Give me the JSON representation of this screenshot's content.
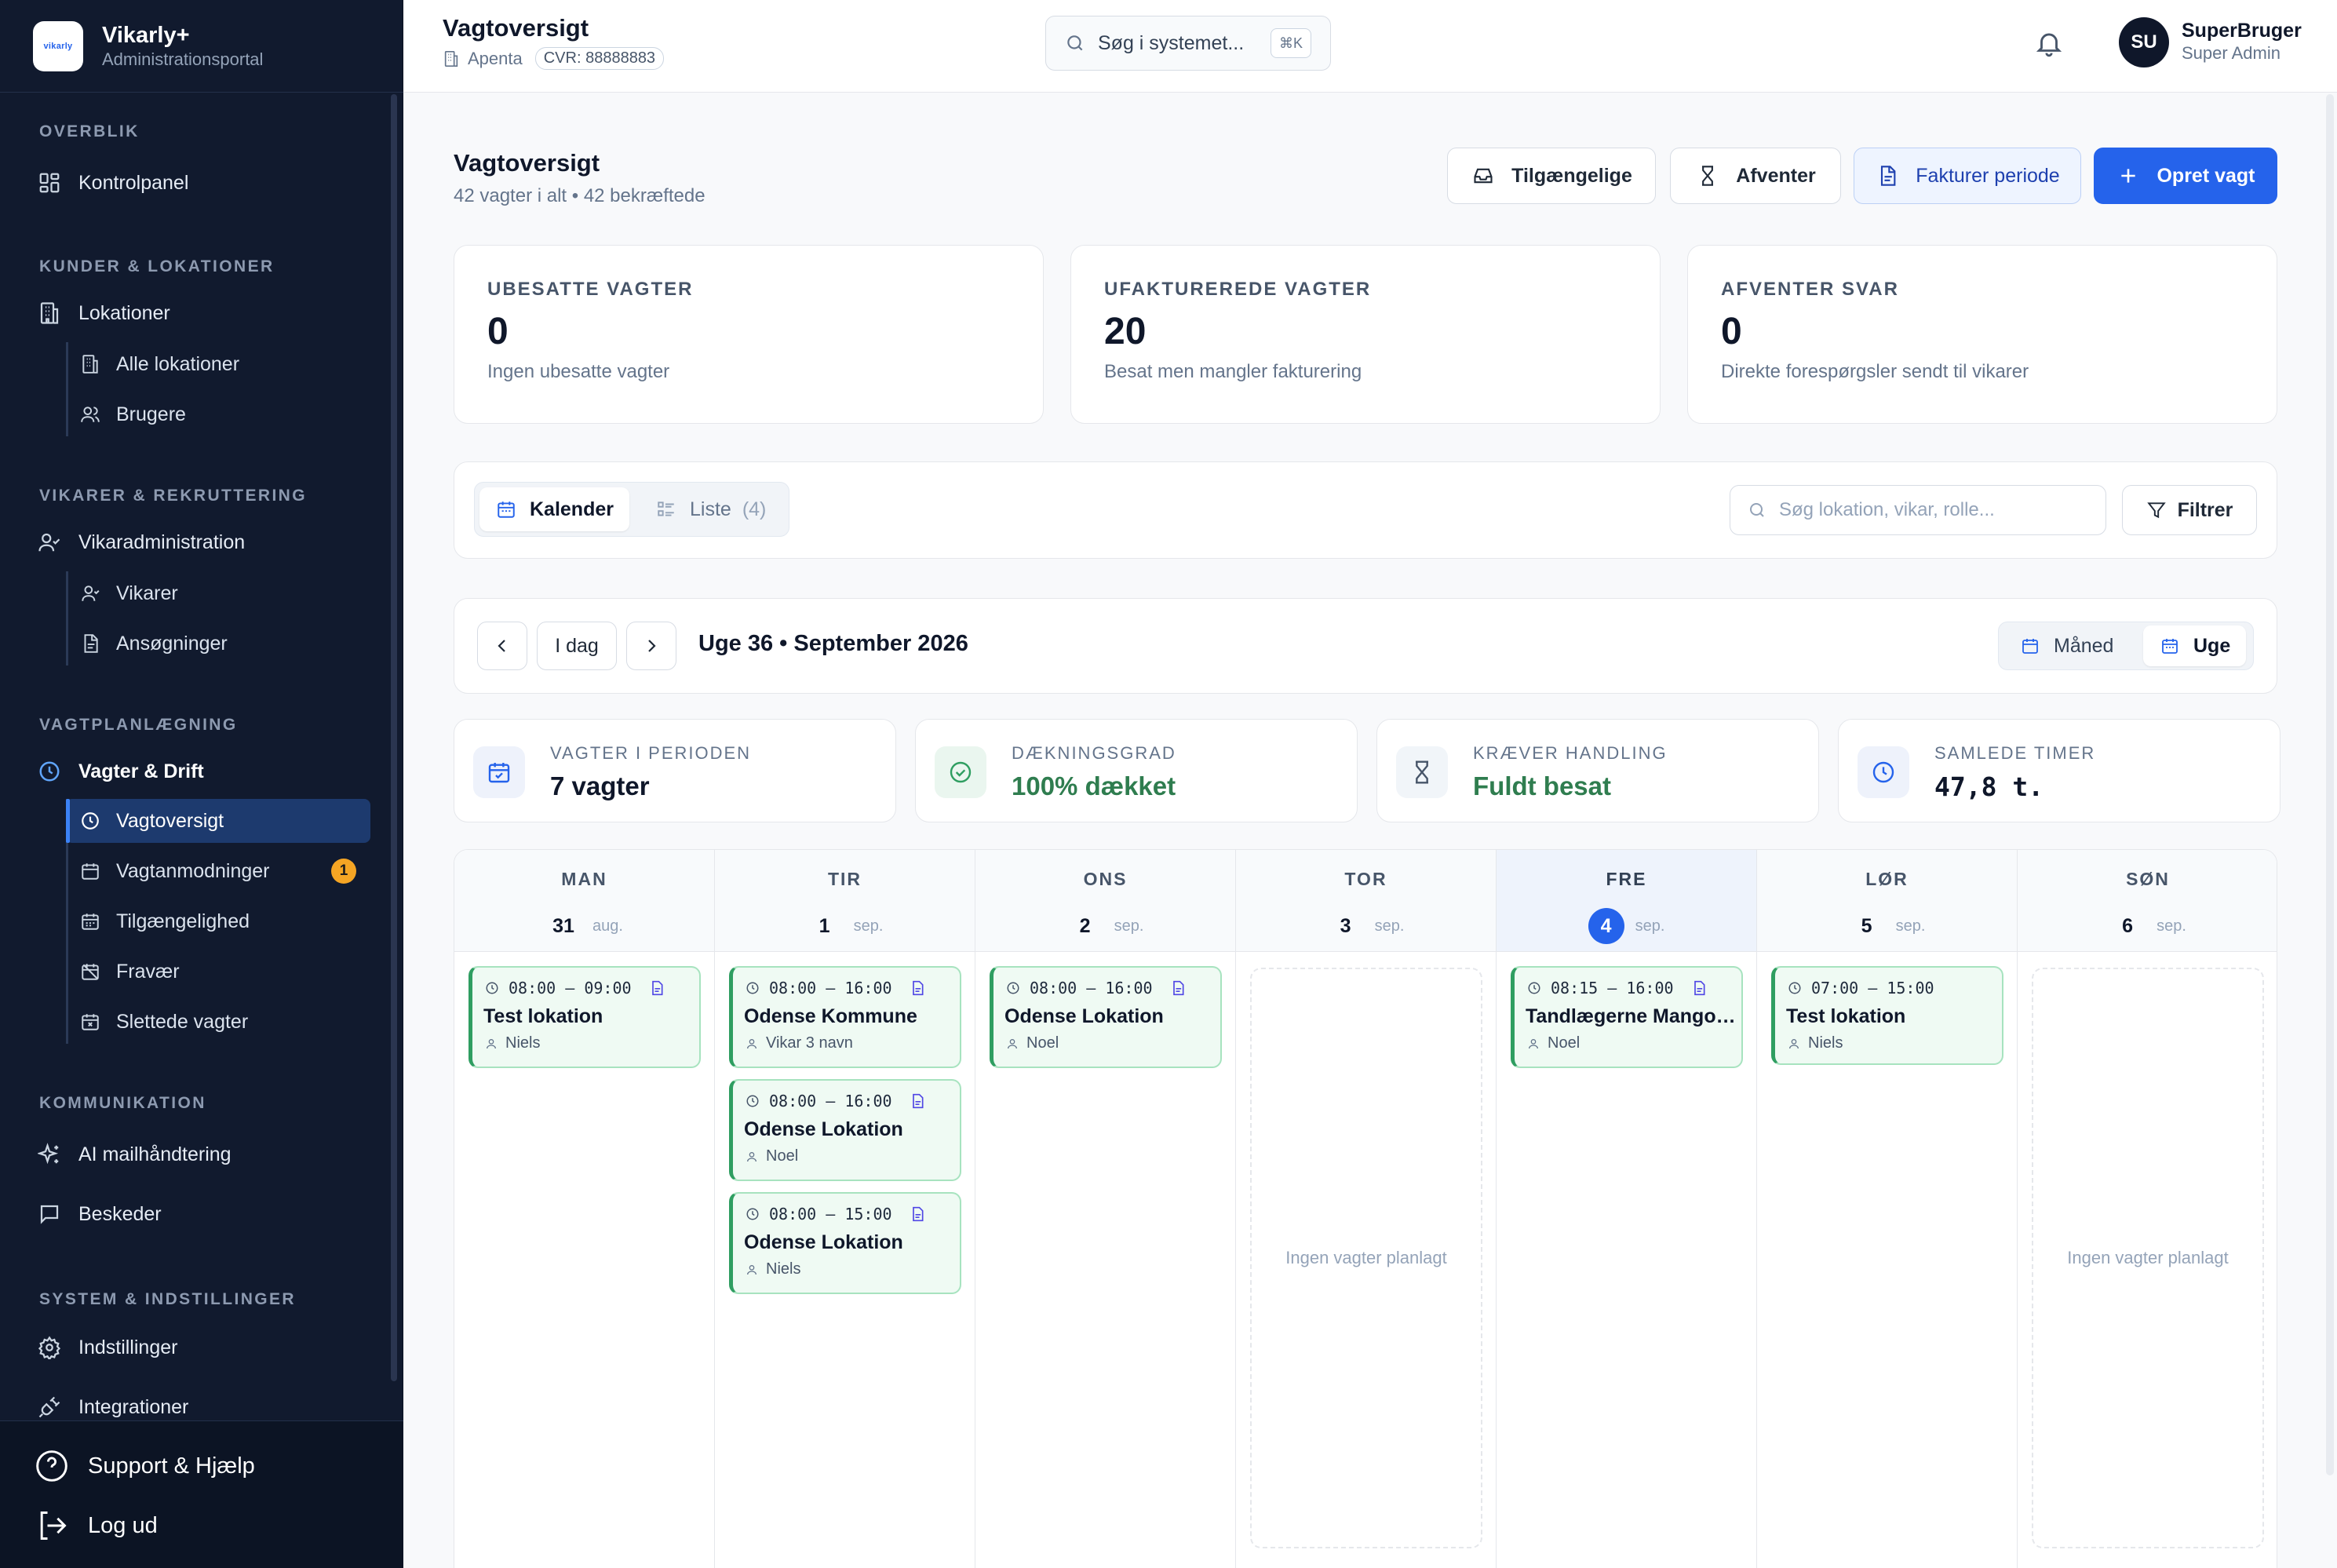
{
  "brand": {
    "name": "Vikarly+",
    "subtitle": "Administrationsportal",
    "logo_text": "vikarly"
  },
  "sidebar": {
    "sections": {
      "overview": "OVERBLIK",
      "customers": "KUNDER & LOKATIONER",
      "temps": "VIKARER & REKRUTTERING",
      "planning": "VAGTPLANLÆGNING",
      "communication": "KOMMUNIKATION",
      "system": "SYSTEM & INDSTILLINGER"
    },
    "items": {
      "dashboard": "Kontrolpanel",
      "locations": "Lokationer",
      "all_locations": "Alle lokationer",
      "users": "Brugere",
      "temp_admin": "Vikaradministration",
      "temps": "Vikarer",
      "applications": "Ansøgninger",
      "shifts_ops": "Vagter & Drift",
      "shift_overview": "Vagtoversigt",
      "shift_requests": "Vagtanmodninger",
      "shift_requests_badge": "1",
      "availability": "Tilgængelighed",
      "absence": "Fravær",
      "deleted_shifts": "Slettede vagter",
      "ai_mail": "AI mailhåndtering",
      "messages": "Beskeder",
      "settings": "Indstillinger",
      "integrations": "Integrationer"
    },
    "footer": {
      "support": "Support & Hjælp",
      "logout": "Log ud"
    }
  },
  "topbar": {
    "title": "Vagtoversigt",
    "company": "Apenta",
    "cvr": "CVR: 88888883",
    "search_placeholder": "Søg i systemet...",
    "search_shortcut": "⌘K",
    "user_initials": "SU",
    "user_name": "SuperBruger",
    "user_role": "Super Admin"
  },
  "page": {
    "title": "Vagtoversigt",
    "subtitle": "42 vagter i alt • 42 bekræftede",
    "actions": {
      "available": "Tilgængelige",
      "pending": "Afventer",
      "invoice": "Fakturer periode",
      "create": "Opret vagt"
    }
  },
  "stats": [
    {
      "label": "UBESATTE VAGTER",
      "value": "0",
      "desc": "Ingen ubesatte vagter"
    },
    {
      "label": "UFAKTUREREDE VAGTER",
      "value": "20",
      "desc": "Besat men mangler fakturering"
    },
    {
      "label": "AFVENTER SVAR",
      "value": "0",
      "desc": "Direkte forespørgsler sendt til vikarer"
    }
  ],
  "view_toggle": {
    "calendar": "Kalender",
    "list": "Liste",
    "list_count": "(4)"
  },
  "filter": {
    "search_placeholder": "Søg lokation, vikar, rolle...",
    "button": "Filtrer"
  },
  "calendar_nav": {
    "today": "I dag",
    "week_label": "Uge 36 • September 2026",
    "month": "Måned",
    "week": "Uge"
  },
  "kpis": [
    {
      "label": "VAGTER I PERIODEN",
      "value": "7 vagter",
      "color": "#0f172a"
    },
    {
      "label": "DÆKNINGSGRAD",
      "value": "100% dækket",
      "color": "#2f7d4f"
    },
    {
      "label": "KRÆVER HANDLING",
      "value": "Fuldt besat",
      "color": "#2f7d4f"
    },
    {
      "label": "SAMLEDE TIMER",
      "value": "47,8 t.",
      "color": "#0f172a"
    }
  ],
  "days": [
    {
      "dow": "MAN",
      "num": "31",
      "mon": "aug."
    },
    {
      "dow": "TIR",
      "num": "1",
      "mon": "sep."
    },
    {
      "dow": "ONS",
      "num": "2",
      "mon": "sep."
    },
    {
      "dow": "TOR",
      "num": "3",
      "mon": "sep.",
      "empty": "Ingen vagter planlagt"
    },
    {
      "dow": "FRE",
      "num": "4",
      "mon": "sep."
    },
    {
      "dow": "LØR",
      "num": "5",
      "mon": "sep."
    },
    {
      "dow": "SØN",
      "num": "6",
      "mon": "sep.",
      "empty": "Ingen vagter planlagt"
    }
  ],
  "shifts": [
    {
      "time": "08:00 – 09:00",
      "title": "Test lokation",
      "person": "Niels"
    },
    {
      "time": "08:00 – 16:00",
      "title": "Odense Kommune",
      "person": "Vikar 3 navn"
    },
    {
      "time": "08:00 – 16:00",
      "title": "Odense Lokation",
      "person": "Noel"
    },
    {
      "time": "08:00 – 15:00",
      "title": "Odense Lokation",
      "person": "Niels"
    },
    {
      "time": "08:00 – 16:00",
      "title": "Odense Lokation",
      "person": "Noel"
    },
    {
      "time": "08:15 – 16:00",
      "title": "Tandlægerne Mangor & Hviid",
      "person": "Noel"
    },
    {
      "time": "07:00 – 15:00",
      "title": "Test lokation",
      "person": "Niels"
    }
  ],
  "colors": {
    "sidebar_bg": "#111a2e",
    "primary": "#2563eb",
    "success": "#2f9e61",
    "badge": "#f5a524"
  }
}
